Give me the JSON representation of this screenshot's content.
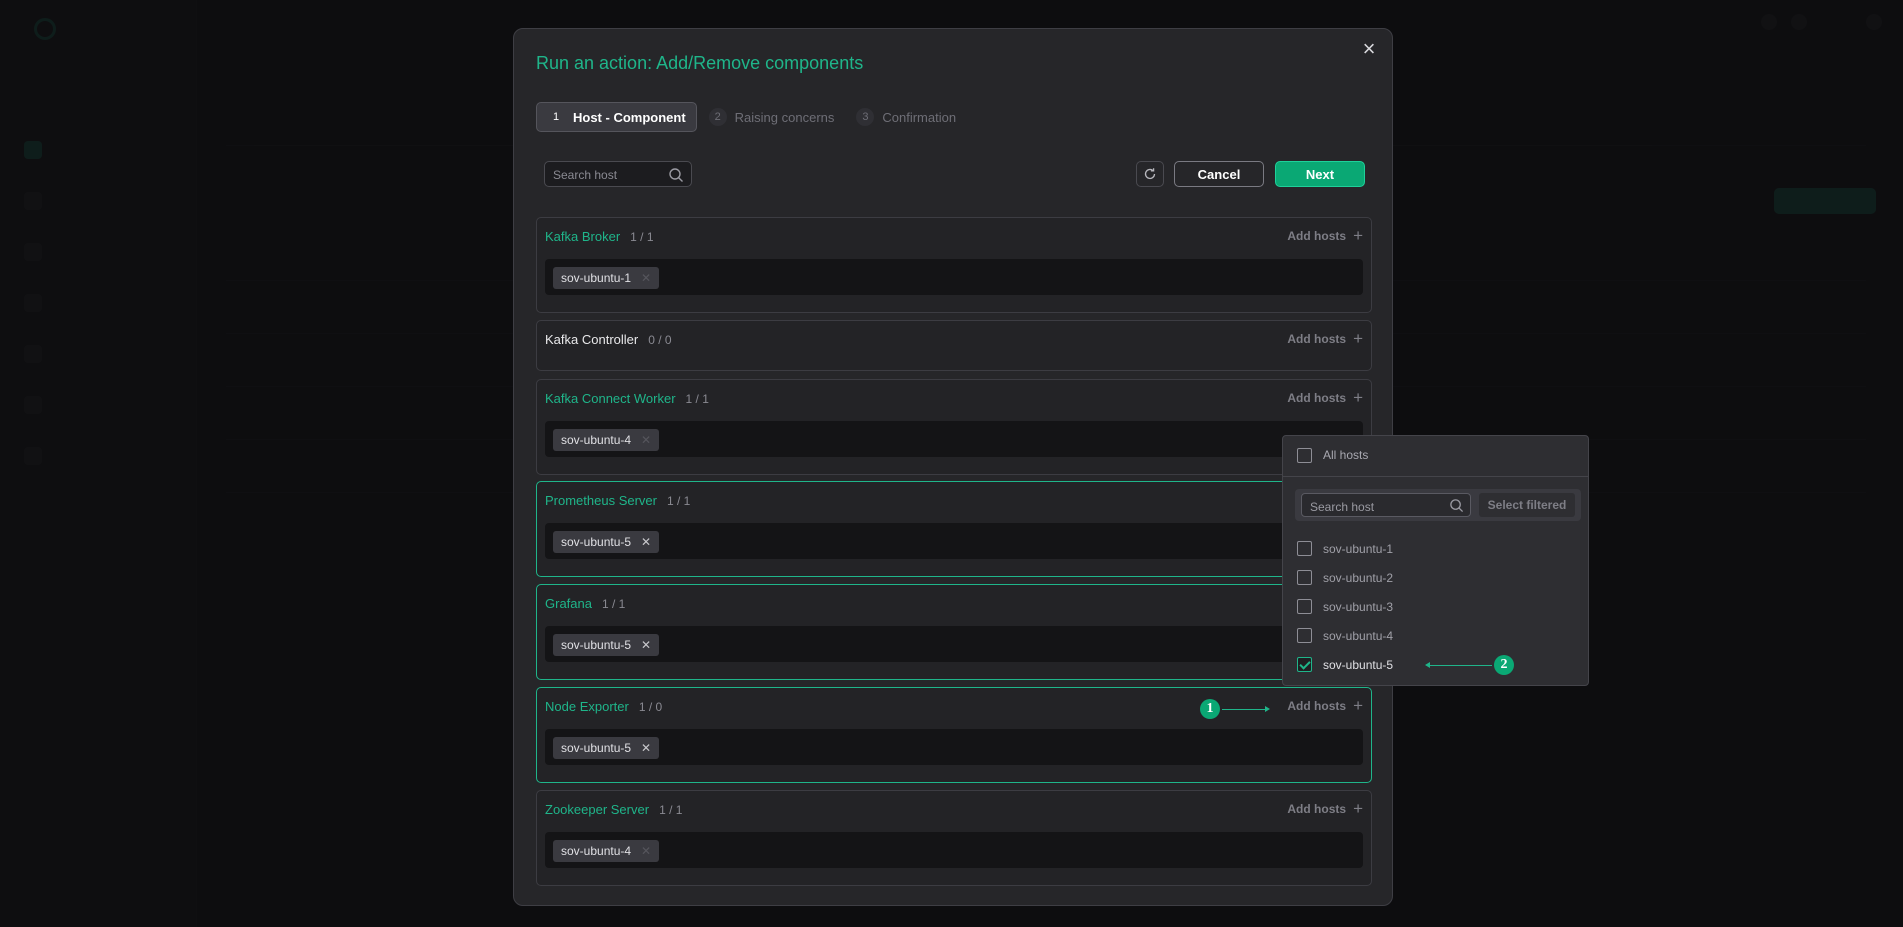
{
  "modal": {
    "title": "Run an action: Add/Remove components",
    "steps": [
      {
        "num": "1",
        "label": "Host - Component"
      },
      {
        "num": "2",
        "label": "Raising concerns"
      },
      {
        "num": "3",
        "label": "Confirmation"
      }
    ],
    "search_placeholder": "Search host",
    "cancel_label": "Cancel",
    "next_label": "Next",
    "add_hosts_label": "Add hosts",
    "components": [
      {
        "name": "Kafka Broker",
        "count": "1 / 1",
        "hosts": [
          "sov-ubuntu-1"
        ]
      },
      {
        "name": "Kafka Controller",
        "count": "0 / 0",
        "hosts": []
      },
      {
        "name": "Kafka Connect Worker",
        "count": "1 / 1",
        "hosts": [
          "sov-ubuntu-4"
        ]
      },
      {
        "name": "Prometheus Server",
        "count": "1 / 1",
        "hosts": [
          "sov-ubuntu-5"
        ]
      },
      {
        "name": "Grafana",
        "count": "1 / 1",
        "hosts": [
          "sov-ubuntu-5"
        ]
      },
      {
        "name": "Node Exporter",
        "count": "1 / 0",
        "hosts": [
          "sov-ubuntu-5"
        ]
      },
      {
        "name": "Zookeeper Server",
        "count": "1 / 1",
        "hosts": [
          "sov-ubuntu-4"
        ]
      }
    ]
  },
  "dropdown": {
    "all_hosts_label": "All hosts",
    "search_placeholder": "Search host",
    "select_filtered_label": "Select filtered",
    "hosts": [
      {
        "name": "sov-ubuntu-1",
        "checked": false
      },
      {
        "name": "sov-ubuntu-2",
        "checked": false
      },
      {
        "name": "sov-ubuntu-3",
        "checked": false
      },
      {
        "name": "sov-ubuntu-4",
        "checked": false
      },
      {
        "name": "sov-ubuntu-5",
        "checked": true
      }
    ]
  },
  "annotations": {
    "badge_1": "1",
    "badge_2": "2"
  },
  "colors": {
    "accent": "#1fb58a",
    "primary_button": "#0aa874",
    "modal_bg": "#262629",
    "page_bg": "#161618"
  }
}
